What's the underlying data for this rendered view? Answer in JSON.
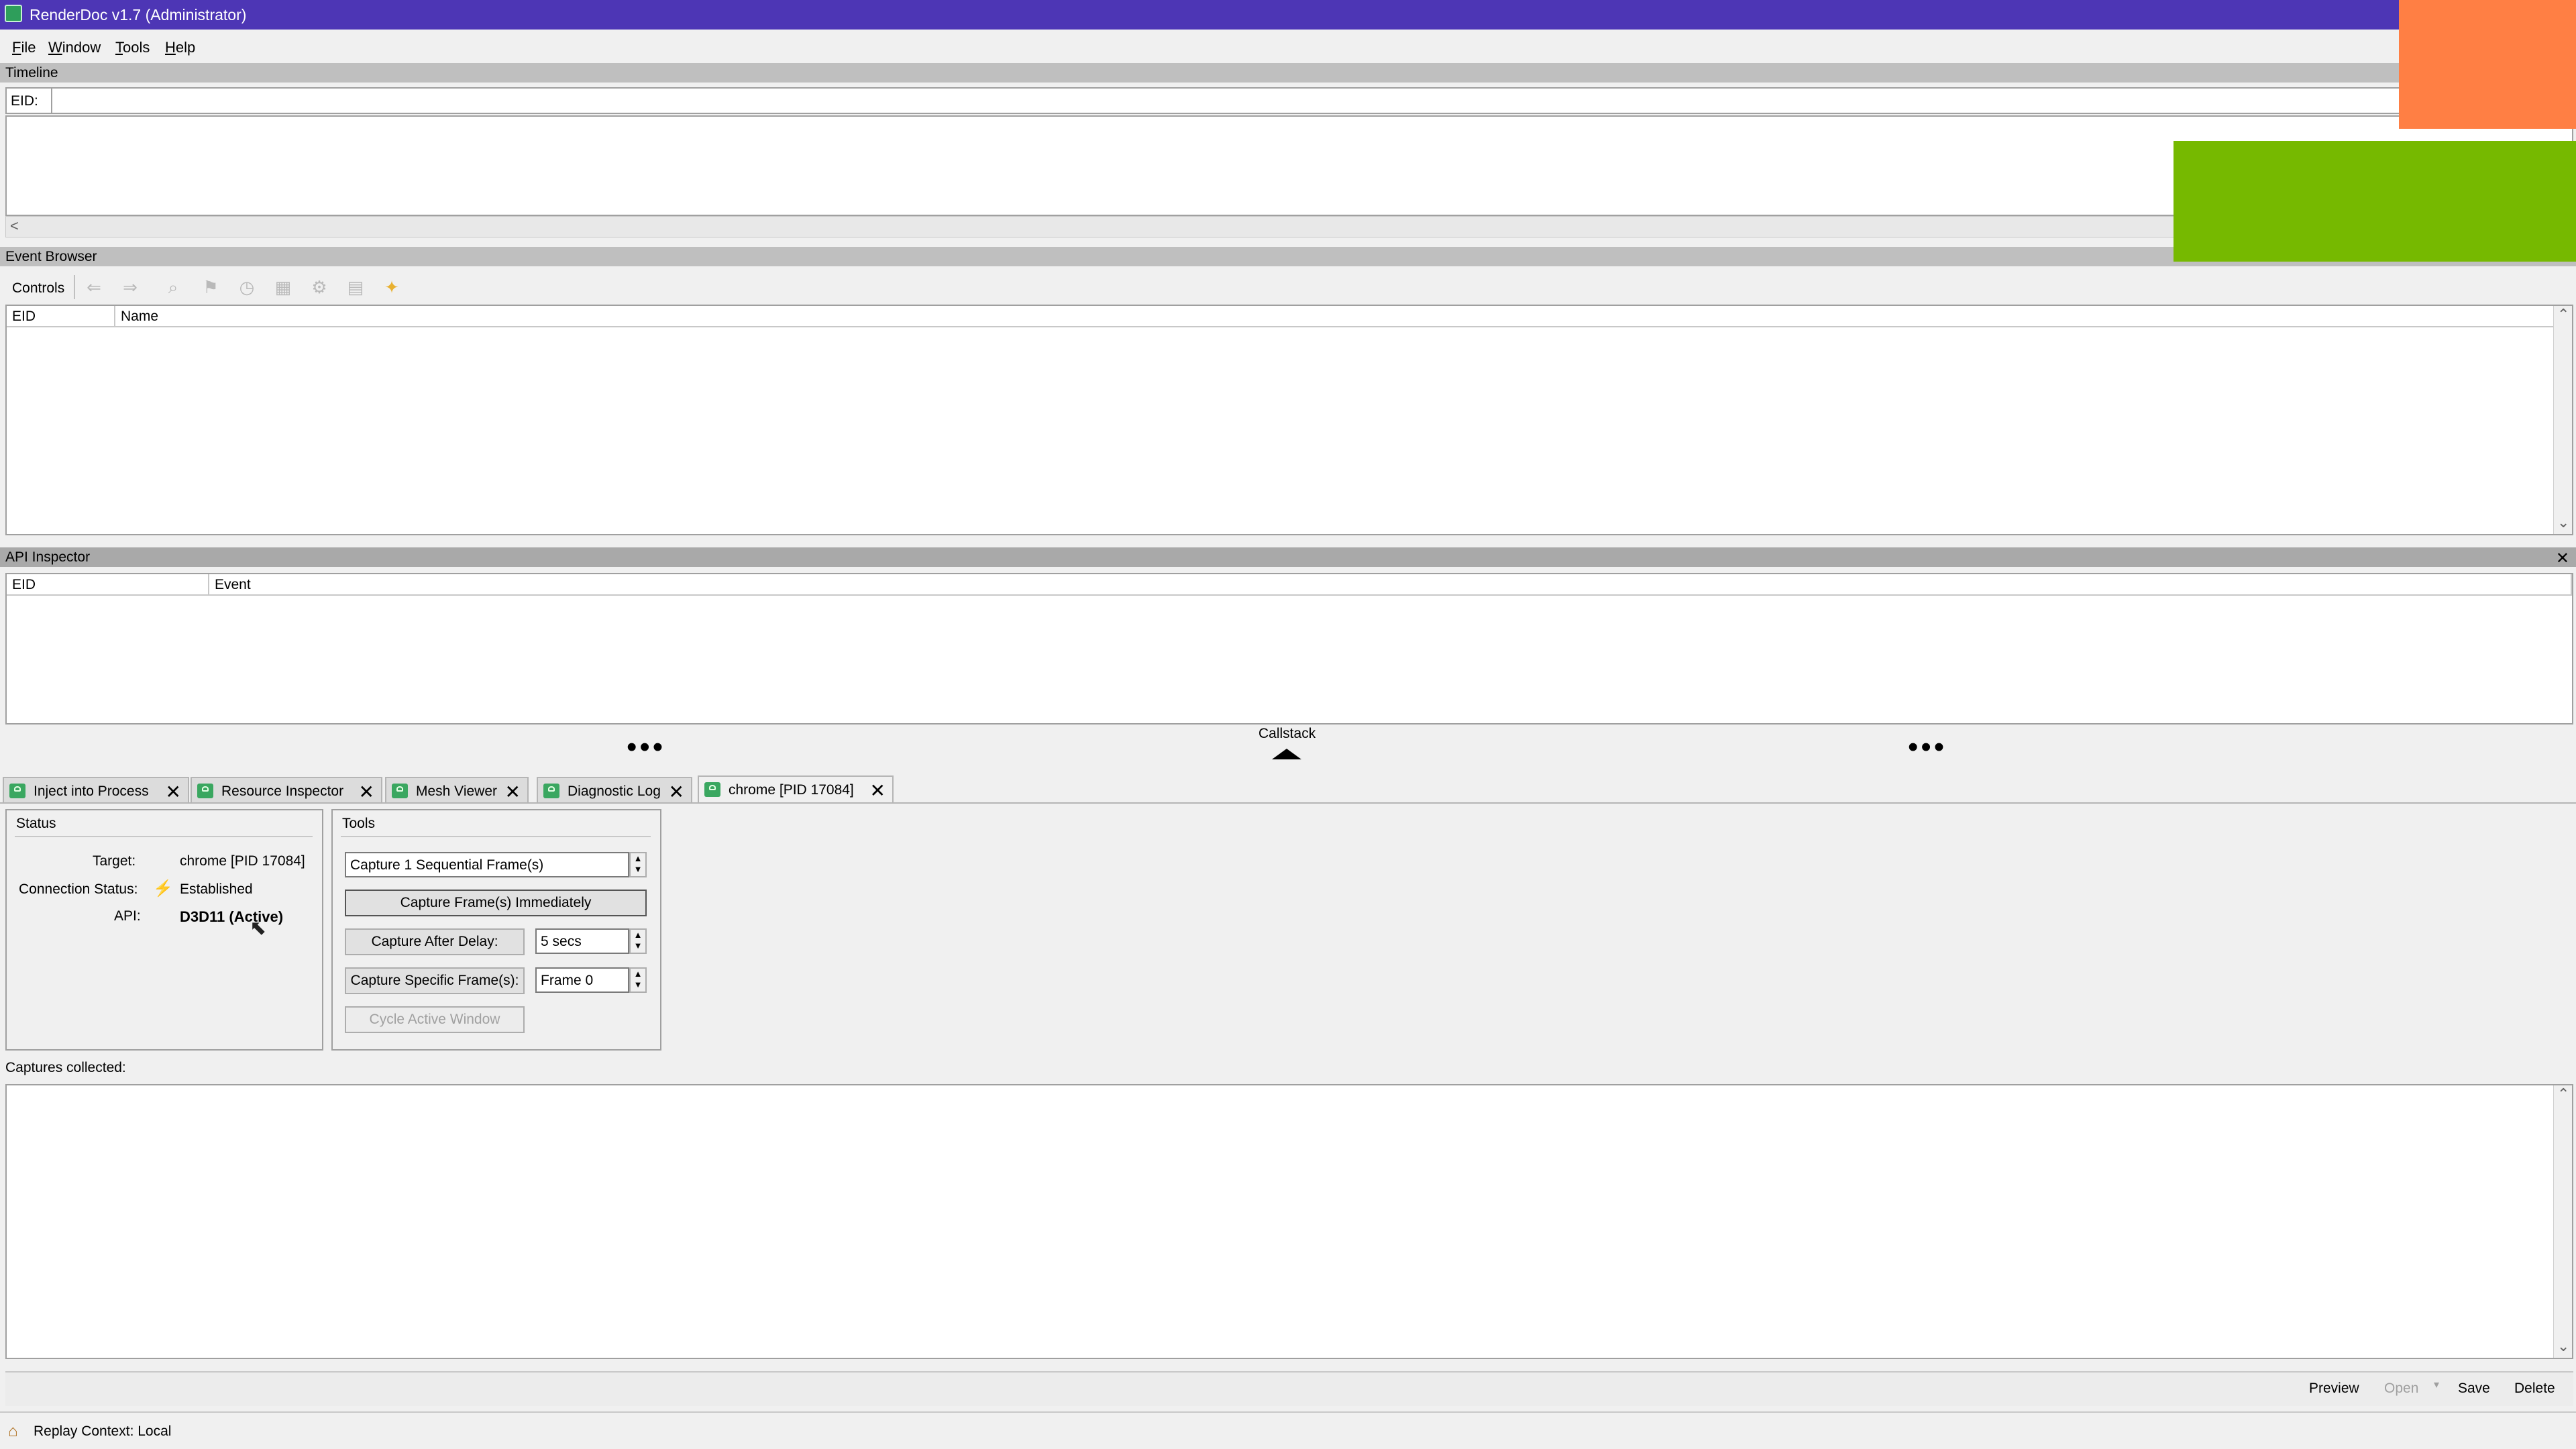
{
  "window": {
    "title": "RenderDoc v1.7 (Administrator)"
  },
  "menu": {
    "items": [
      "File",
      "Window",
      "Tools",
      "Help"
    ]
  },
  "timeline": {
    "header": "Timeline",
    "eid_label": "EID:",
    "scroll_left": "<"
  },
  "event_browser": {
    "header": "Event Browser",
    "controls_label": "Controls",
    "columns": [
      "EID",
      "Name"
    ]
  },
  "api_inspector": {
    "header": "API Inspector",
    "close": "✕",
    "columns": [
      "EID",
      "Event"
    ]
  },
  "callstack": {
    "label": "Callstack",
    "dots": "•••"
  },
  "tabs": [
    {
      "label": "Inject into Process",
      "close": "✕"
    },
    {
      "label": "Resource Inspector",
      "close": "✕"
    },
    {
      "label": "Mesh Viewer",
      "close": "✕"
    },
    {
      "label": "Diagnostic Log",
      "close": "✕"
    },
    {
      "label": "chrome [PID 17084]",
      "close": "✕"
    }
  ],
  "status": {
    "title": "Status",
    "target_label": "Target:",
    "target_value": "chrome [PID 17084]",
    "connection_label": "Connection Status:",
    "connection_value": "Established",
    "api_label": "API:",
    "api_value": "D3D11 (Active)"
  },
  "tools": {
    "title": "Tools",
    "sequential_value": "Capture 1 Sequential Frame(s)",
    "capture_immediately": "Capture Frame(s) Immediately",
    "capture_after_delay": "Capture After Delay:",
    "delay_value": "5 secs",
    "capture_specific": "Capture Specific Frame(s):",
    "frame_value": "Frame 0",
    "cycle_window": "Cycle Active Window"
  },
  "captures": {
    "label": "Captures collected:",
    "buttons": {
      "preview": "Preview",
      "open": "Open",
      "save": "Save",
      "delete": "Delete"
    }
  },
  "statusbar": {
    "replay_context": "Replay Context: Local"
  },
  "overlay_colors": {
    "orange": "#ff7f44",
    "green": "#76b900"
  },
  "icons": [
    "back-arrow-icon",
    "forward-arrow-icon",
    "find-icon",
    "bookmark-flag-icon",
    "timer-icon",
    "chart-icon",
    "settings-icon",
    "save-icon",
    "star-icon"
  ]
}
